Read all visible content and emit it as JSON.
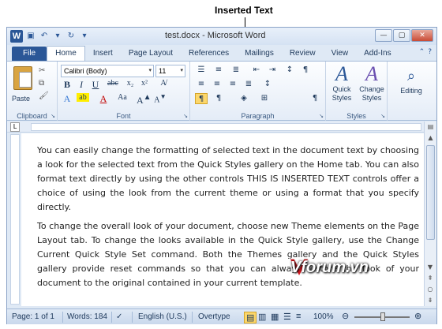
{
  "callout": {
    "label": "Inserted Text"
  },
  "window": {
    "title": "test.docx - Microsoft Word",
    "app_icon": "W"
  },
  "tabs": [
    {
      "label": "File"
    },
    {
      "label": "Home"
    },
    {
      "label": "Insert"
    },
    {
      "label": "Page Layout"
    },
    {
      "label": "References"
    },
    {
      "label": "Mailings"
    },
    {
      "label": "Review"
    },
    {
      "label": "View"
    },
    {
      "label": "Add-Ins"
    }
  ],
  "ribbon": {
    "clipboard": {
      "paste_label": "Paste",
      "group_label": "Clipboard"
    },
    "font": {
      "font_name": "Calibri (Body)",
      "font_size": "11",
      "group_label": "Font"
    },
    "paragraph": {
      "group_label": "Paragraph"
    },
    "styles": {
      "quick_styles": "Quick Styles",
      "change_styles": "Change Styles",
      "group_label": "Styles"
    },
    "editing": {
      "label": "Editing"
    }
  },
  "document": {
    "paragraphs": [
      "You can easily change the formatting of selected text in the document text by choosing a look for the selected text from the Quick Styles gallery on the Home tab. You can also format text directly by using the other controls THIS IS INSERTED TEXT controls offer a choice of using the look from the current theme or using a format that you specify directly.",
      "To change the overall look of your document, choose new Theme elements on the Page Layout tab. To change the looks available in the Quick Style gallery, use the Change Current Quick Style Set command. Both the Themes gallery and the Quick Styles gallery provide reset commands so that you can always restore the look of your document to the original contained in your current template."
    ]
  },
  "status": {
    "page": "Page: 1 of 1",
    "words": "Words: 184",
    "language": "English (U.S.)",
    "overtype": "Overtype",
    "zoom": "100%"
  },
  "watermark": {
    "text": "Vforum.vn"
  }
}
